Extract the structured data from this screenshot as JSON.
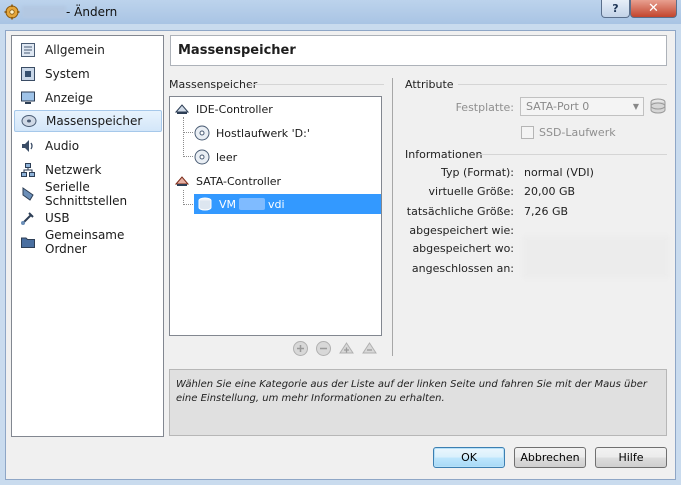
{
  "window": {
    "title": "- Ändern",
    "help_glyph": "?",
    "close_glyph": "✕"
  },
  "sidebar": {
    "items": [
      {
        "label": "Allgemein",
        "icon": "settings-general-icon"
      },
      {
        "label": "System",
        "icon": "system-chip-icon"
      },
      {
        "label": "Anzeige",
        "icon": "display-monitor-icon"
      },
      {
        "label": "Massenspeicher",
        "icon": "storage-disk-icon",
        "selected": true
      },
      {
        "label": "Audio",
        "icon": "audio-speaker-icon"
      },
      {
        "label": "Netzwerk",
        "icon": "network-icon"
      },
      {
        "label": "Serielle Schnittstellen",
        "icon": "serial-port-icon"
      },
      {
        "label": "USB",
        "icon": "usb-icon"
      },
      {
        "label": "Gemeinsame Ordner",
        "icon": "shared-folder-icon"
      }
    ]
  },
  "header": {
    "title": "Massenspeicher"
  },
  "storage": {
    "group_label": "Massenspeicher",
    "tree": {
      "ide_controller": "IDE-Controller",
      "ide_children": [
        "Hostlaufwerk 'D:'",
        "leer"
      ],
      "sata_controller": "SATA-Controller",
      "sata_disk_prefix": "VM",
      "sata_disk_suffix": "vdi"
    }
  },
  "attributes": {
    "group_label": "Attribute",
    "disk_label": "Festplatte:",
    "disk_value": "SATA-Port 0",
    "ssd_label": "SSD-Laufwerk",
    "ssd_checked": false
  },
  "information": {
    "group_label": "Informationen",
    "rows": [
      {
        "label": "Typ (Format):",
        "value": "normal (VDI)"
      },
      {
        "label": "virtuelle Größe:",
        "value": "20,00 GB"
      },
      {
        "label": "tatsächliche Größe:",
        "value": "7,26 GB"
      },
      {
        "label": "abgespeichert wie:",
        "value": ""
      },
      {
        "label": "abgespeichert wo:",
        "value": ""
      },
      {
        "label": "angeschlossen an:",
        "value": ""
      }
    ]
  },
  "description": {
    "text": "Wählen Sie eine Kategorie aus der Liste auf der linken Seite und fahren Sie mit der Maus über eine Einstellung, um mehr Informationen zu erhalten."
  },
  "buttons": {
    "ok": "OK",
    "cancel": "Abbrechen",
    "help": "Hilfe"
  },
  "colors": {
    "selection": "#3399ff",
    "window_bg": "#f0f0f0"
  }
}
